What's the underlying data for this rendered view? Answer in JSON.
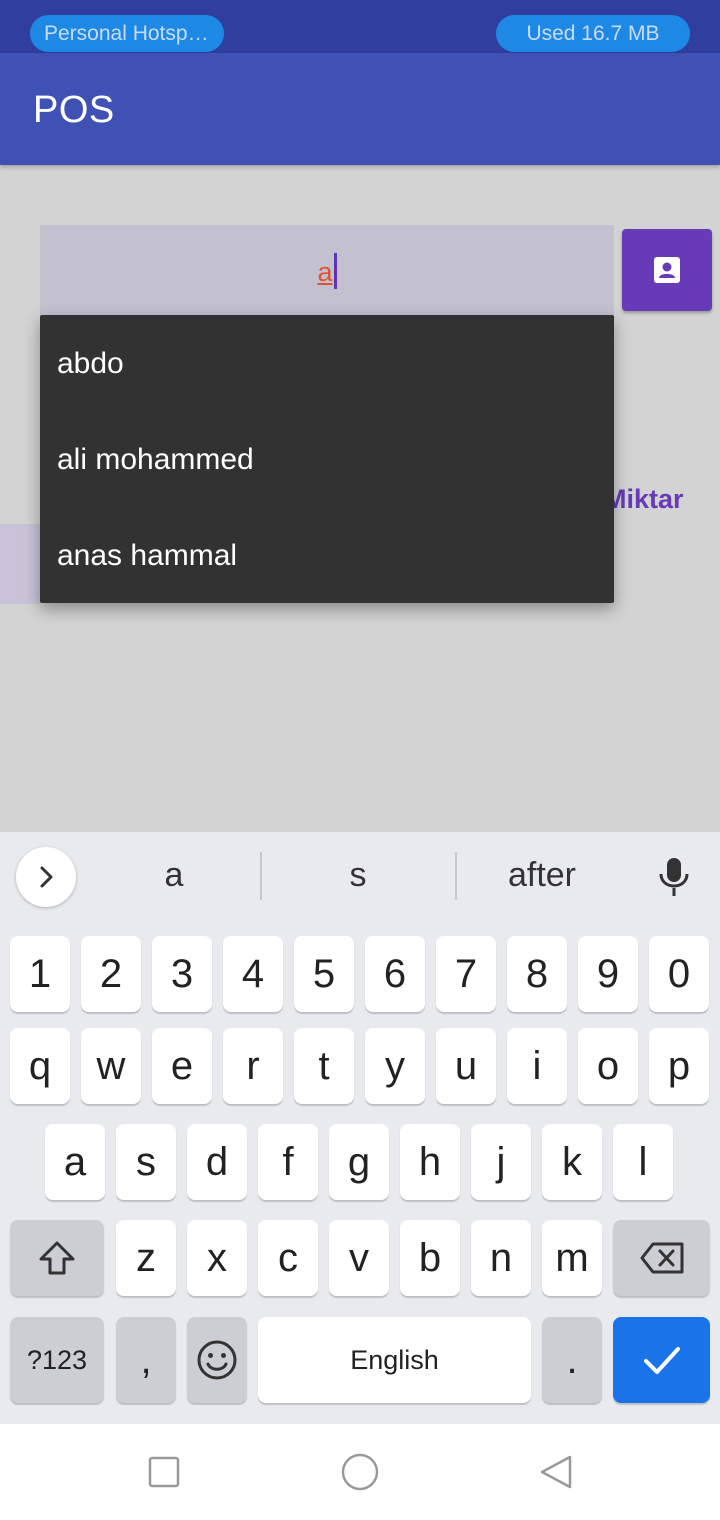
{
  "status_bar": {
    "hotspot": "Personal Hotspo...",
    "usage": "Used  16.7 MB"
  },
  "app_bar": {
    "title": "POS"
  },
  "search": {
    "value": "a"
  },
  "background": {
    "partial_label": "Miktar"
  },
  "dropdown": {
    "items": [
      "abdo",
      "ali mohammed",
      "anas hammal"
    ]
  },
  "keyboard": {
    "suggestions": [
      "a",
      "s",
      "after"
    ],
    "number_row": [
      "1",
      "2",
      "3",
      "4",
      "5",
      "6",
      "7",
      "8",
      "9",
      "0"
    ],
    "row1": [
      "q",
      "w",
      "e",
      "r",
      "t",
      "y",
      "u",
      "i",
      "o",
      "p"
    ],
    "row2": [
      "a",
      "s",
      "d",
      "f",
      "g",
      "h",
      "j",
      "k",
      "l"
    ],
    "row3": [
      "z",
      "x",
      "c",
      "v",
      "b",
      "n",
      "m"
    ],
    "symbols_label": "?123",
    "comma": ",",
    "space_label": "English",
    "period": "."
  },
  "colors": {
    "primary": "#3f51b5",
    "primary_dark": "#303f9f",
    "accent": "#673ab7",
    "keyboard_enter": "#1a73e8"
  }
}
